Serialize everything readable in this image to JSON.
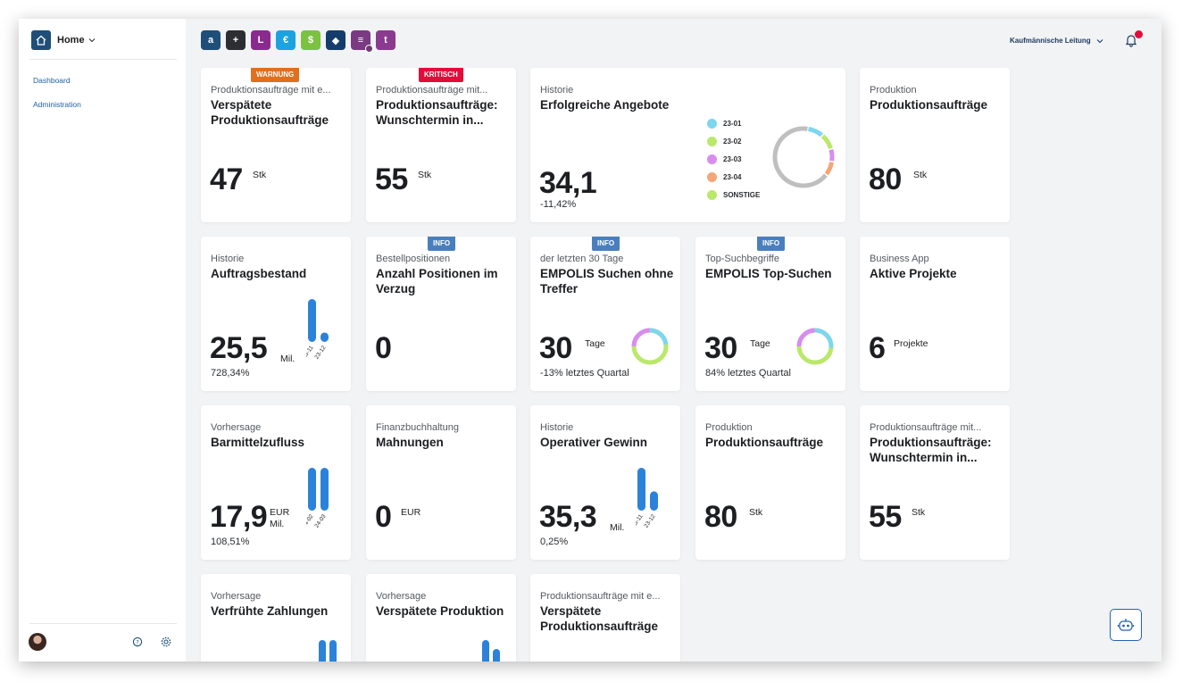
{
  "sidebar": {
    "home_label": "Home",
    "items": [
      {
        "label": "Dashboard"
      },
      {
        "label": "Administration"
      }
    ]
  },
  "topbar": {
    "apps": [
      {
        "name": "search-app",
        "glyph": "a",
        "color": "#1f4e79"
      },
      {
        "name": "plus-app",
        "glyph": "+",
        "color": "#2b2f33"
      },
      {
        "name": "ln-app",
        "glyph": "L",
        "color": "#8a2a8f"
      },
      {
        "name": "gear-app",
        "glyph": "€",
        "color": "#1aa3e0"
      },
      {
        "name": "euro-app",
        "glyph": "$",
        "color": "#7cc242"
      },
      {
        "name": "pin-app",
        "glyph": "◆",
        "color": "#153d6b"
      },
      {
        "name": "doc-app",
        "glyph": "≡",
        "color": "#7a3a82"
      },
      {
        "name": "t-app",
        "glyph": "t",
        "color": "#8a3a8f"
      }
    ],
    "role_label": "Kaufmännische Leitung"
  },
  "colors": {
    "info": "#4a7fbd",
    "warnung": "#e0701f",
    "kritisch": "#e30b3a",
    "bar": "#2b82d9"
  },
  "cards": [
    {
      "badge": "WARNUNG",
      "category": "Produktionsaufträge mit e...",
      "title": "Verspätete Produktionsaufträge",
      "value": "47",
      "unit": "Stk"
    },
    {
      "badge": "KRITISCH",
      "category": "Produktionsaufträge mit...",
      "title": "Produktionsaufträge: Wunschtermin in...",
      "value": "55",
      "unit": "Stk"
    },
    {
      "category": "Historie",
      "title": "Erfolgreiche Angebote",
      "value": "34,1",
      "sub": "-11,42%",
      "legend": [
        {
          "label": "23-01",
          "color": "#7dd6ee"
        },
        {
          "label": "23-02",
          "color": "#b9e86a"
        },
        {
          "label": "23-03",
          "color": "#d98cf0"
        },
        {
          "label": "23-04",
          "color": "#f4a676"
        },
        {
          "label": "SONSTIGE",
          "color": "#b9e86a"
        }
      ]
    },
    {
      "category": "Produktion",
      "title": "Produktionsaufträge",
      "value": "80",
      "unit": "Stk"
    },
    {
      "category": "Historie",
      "title": "Auftragsbestand",
      "value": "25,5",
      "unit": "Mil.",
      "sub": "728,34%",
      "bars": {
        "labels": [
          "23-11",
          "23-12"
        ],
        "values": [
          1.0,
          0.22
        ]
      }
    },
    {
      "badge": "INFO",
      "category": "Bestellpositionen",
      "title": "Anzahl Positionen im Verzug",
      "value": "0"
    },
    {
      "badge": "INFO",
      "category": "der letzten 30 Tage",
      "title": "EMPOLIS Suchen ohne Treffer",
      "value": "30",
      "unit": "Tage",
      "sub": "-13% letztes Quartal"
    },
    {
      "badge": "INFO",
      "category": "Top-Suchbegriffe",
      "title": "EMPOLIS Top-Suchen",
      "value": "30",
      "unit": "Tage",
      "sub": "84% letztes Quartal"
    },
    {
      "category": "Business App",
      "title": "Aktive Projekte",
      "value": "6",
      "unit": "Projekte"
    },
    {
      "category": "Vorhersage",
      "title": "Barmittelzufluss",
      "value": "17,9",
      "unit": "EUR Mil.",
      "unit1": "EUR",
      "unit2": "Mil.",
      "sub": "108,51%",
      "bars": {
        "labels": [
          "24-02",
          "24-03"
        ],
        "values": [
          1.0,
          1.0
        ]
      }
    },
    {
      "category": "Finanzbuchhaltung",
      "title": "Mahnungen",
      "value": "0",
      "unit": "EUR"
    },
    {
      "category": "Historie",
      "title": "Operativer Gewinn",
      "value": "35,3",
      "unit": "Mil.",
      "sub": "0,25%",
      "bars": {
        "labels": [
          "23-11",
          "23-12"
        ],
        "values": [
          1.0,
          0.45
        ]
      }
    },
    {
      "category": "Produktion",
      "title": "Produktionsaufträge",
      "value": "80",
      "unit": "Stk"
    },
    {
      "category": "Produktionsaufträge mit...",
      "title": "Produktionsaufträge: Wunschtermin in...",
      "value": "55",
      "unit": "Stk"
    },
    {
      "category": "Vorhersage",
      "title": "Verfrühte Zahlungen"
    },
    {
      "category": "Vorhersage",
      "title": "Verspätete Produktion"
    },
    {
      "category": "Produktionsaufträge mit e...",
      "title": "Verspätete Produktionsaufträge"
    }
  ]
}
